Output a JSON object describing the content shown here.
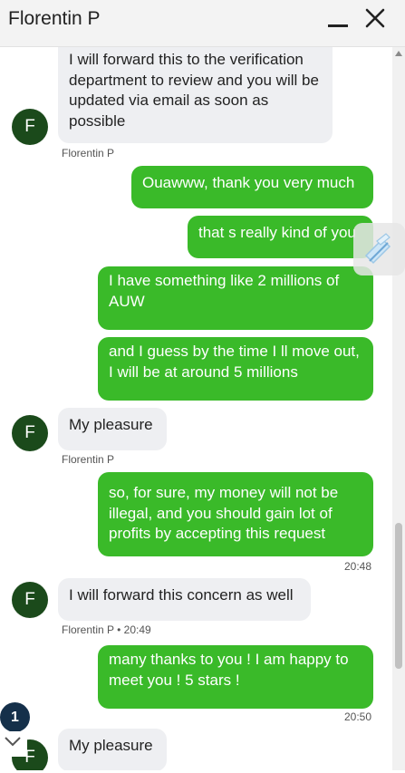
{
  "header": {
    "title": "Florentin P"
  },
  "agent": {
    "initial": "F"
  },
  "messages": [
    {
      "text": "I will forward this to the verification department to review and you will be updated via email as soon as possible",
      "meta": "Florentin P"
    },
    {
      "text": "Ouawww, thank you very much"
    },
    {
      "text": "that s really kind of you"
    },
    {
      "text": "I have something like 2 millions of AUW"
    },
    {
      "text": "and I guess by the time I ll move out, I will be at around 5 millions"
    },
    {
      "text": "My pleasure",
      "meta": "Florentin P"
    },
    {
      "text": "so, for sure, my money will not be illegal, and you should gain lot of profits by accepting this request",
      "time": "20:48"
    },
    {
      "text": "I will forward this concern as well",
      "meta": "Florentin P • 20:49"
    },
    {
      "text": "many thanks to you ! I am happy to meet you ! 5 stars !",
      "time": "20:50"
    },
    {
      "text": "My pleasure"
    }
  ],
  "unread_count": "1",
  "colors": {
    "user_bubble": "#3aba29",
    "agent_bubble": "#eeeff2",
    "avatar": "#1b4a1b",
    "badge": "#15304a"
  },
  "icons": {
    "minimize": "minimize-icon",
    "close": "close-icon",
    "scroll_down": "chevron-down-icon",
    "widget": "floating-widget-icon"
  }
}
